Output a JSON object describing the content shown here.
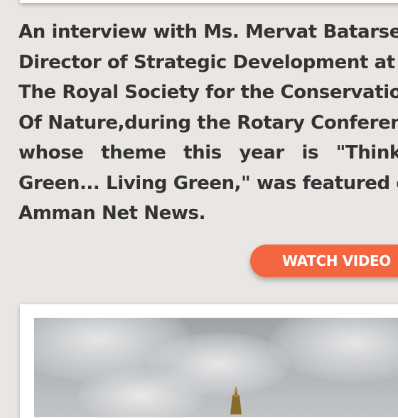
{
  "article": {
    "lines": [
      "An interview with Ms. Mervat Batarseh,",
      "Director of Strategic Development at",
      "The Royal Society for the Conservation",
      "Of Nature,during the Rotary Conference,",
      "whose theme this year is \"Thinking",
      "Green... Living Green,\" was featured on",
      "Amman Net News."
    ]
  },
  "watch_button": {
    "label": "WATCH VIDEO"
  },
  "colors": {
    "background": "#e9e6e3",
    "text": "#333333",
    "accent": "#f3663f",
    "card": "#ffffff"
  }
}
